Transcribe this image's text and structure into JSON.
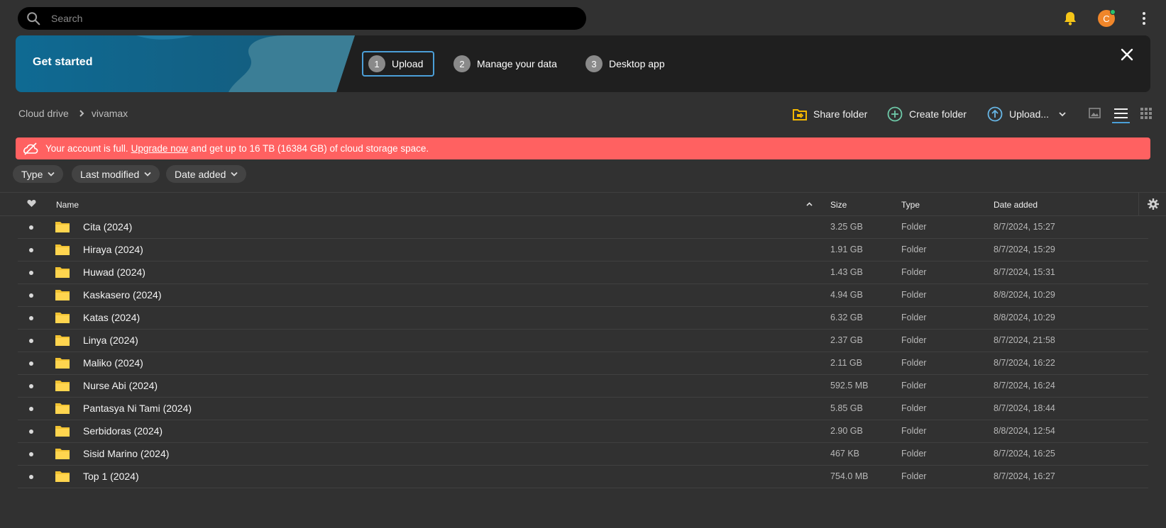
{
  "search": {
    "placeholder": "Search"
  },
  "header": {
    "avatar_letter": "C"
  },
  "get_started": {
    "title": "Get started",
    "steps": [
      {
        "num": "1",
        "label": "Upload"
      },
      {
        "num": "2",
        "label": "Manage your data"
      },
      {
        "num": "3",
        "label": "Desktop app"
      }
    ]
  },
  "breadcrumb": {
    "root": "Cloud drive",
    "current": "vivamax"
  },
  "toolbar": {
    "share_folder": "Share folder",
    "create_folder": "Create folder",
    "upload": "Upload..."
  },
  "alert": {
    "pre": "Your account is full.",
    "link": "Upgrade now",
    "post": "and get up to 16 TB (16384 GB) of cloud storage space."
  },
  "filters": {
    "type": "Type",
    "last_modified": "Last modified",
    "date_added": "Date added"
  },
  "table": {
    "columns": {
      "name": "Name",
      "size": "Size",
      "type": "Type",
      "date_added": "Date added"
    },
    "rows": [
      {
        "name": "Cita (2024)",
        "size": "3.25 GB",
        "type": "Folder",
        "date": "8/7/2024, 15:27"
      },
      {
        "name": "Hiraya (2024)",
        "size": "1.91 GB",
        "type": "Folder",
        "date": "8/7/2024, 15:29"
      },
      {
        "name": "Huwad (2024)",
        "size": "1.43 GB",
        "type": "Folder",
        "date": "8/7/2024, 15:31"
      },
      {
        "name": "Kaskasero (2024)",
        "size": "4.94 GB",
        "type": "Folder",
        "date": "8/8/2024, 10:29"
      },
      {
        "name": "Katas (2024)",
        "size": "6.32 GB",
        "type": "Folder",
        "date": "8/8/2024, 10:29"
      },
      {
        "name": "Linya (2024)",
        "size": "2.37 GB",
        "type": "Folder",
        "date": "8/7/2024, 21:58"
      },
      {
        "name": "Maliko (2024)",
        "size": "2.11 GB",
        "type": "Folder",
        "date": "8/7/2024, 16:22"
      },
      {
        "name": "Nurse Abi (2024)",
        "size": "592.5 MB",
        "type": "Folder",
        "date": "8/7/2024, 16:24"
      },
      {
        "name": "Pantasya Ni Tami (2024)",
        "size": "5.85 GB",
        "type": "Folder",
        "date": "8/7/2024, 18:44"
      },
      {
        "name": "Serbidoras (2024)",
        "size": "2.90 GB",
        "type": "Folder",
        "date": "8/8/2024, 12:54"
      },
      {
        "name": "Sisid Marino (2024)",
        "size": "467 KB",
        "type": "Folder",
        "date": "8/7/2024, 16:25"
      },
      {
        "name": "Top 1 (2024)",
        "size": "754.0 MB",
        "type": "Folder",
        "date": "8/7/2024, 16:27"
      }
    ]
  },
  "icons": {
    "search": "search-icon",
    "bell": "bell-icon",
    "menu": "more-vertical-icon",
    "close": "close-icon",
    "folder": "folder-icon",
    "heart": "heart-icon",
    "gear": "gear-icon"
  },
  "colors": {
    "accent": "#4b9fd8",
    "alert": "#ff6161",
    "folder": "#ffd54f",
    "avatar": "#f0862a",
    "share": "#f5b800",
    "create": "#6ec9a8",
    "upload": "#67b6e6"
  }
}
